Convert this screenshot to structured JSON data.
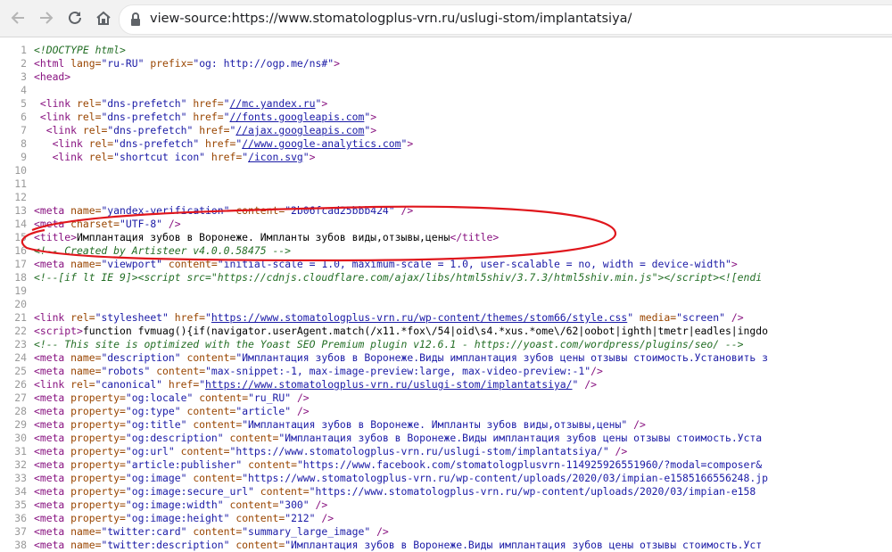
{
  "browser": {
    "url": "view-source:https://www.stomatologplus-vrn.ru/uslugi-stom/implantatsiya/",
    "back_icon": "back-arrow-icon",
    "forward_icon": "forward-arrow-icon",
    "reload_icon": "reload-icon",
    "home_icon": "home-icon",
    "lock_icon": "lock-icon"
  },
  "source_lines": [
    {
      "n": "1",
      "html": "<span class='comment'>&lt;!DOCTYPE html&gt;</span>"
    },
    {
      "n": "2",
      "html": "<span class='tag'>&lt;html</span> <span class='attr'>lang=</span><span class='val'>\"ru-RU\"</span> <span class='attr'>prefix=</span><span class='val'>\"og: http://ogp.me/ns#\"</span><span class='tag'>&gt;</span>"
    },
    {
      "n": "3",
      "html": "<span class='tag'>&lt;head&gt;</span>"
    },
    {
      "n": "4",
      "html": ""
    },
    {
      "n": "5",
      "html": " <span class='tag'>&lt;link</span> <span class='attr'>rel=</span><span class='val'>\"dns-prefetch\"</span> <span class='attr'>href=</span><span class='val'>\"<span class='link'>//mc.yandex.ru</span>\"</span><span class='tag'>&gt;</span>"
    },
    {
      "n": "6",
      "html": " <span class='tag'>&lt;link</span> <span class='attr'>rel=</span><span class='val'>\"dns-prefetch\"</span> <span class='attr'>href=</span><span class='val'>\"<span class='link'>//fonts.googleapis.com</span>\"</span><span class='tag'>&gt;</span>"
    },
    {
      "n": "7",
      "html": "  <span class='tag'>&lt;link</span> <span class='attr'>rel=</span><span class='val'>\"dns-prefetch\"</span> <span class='attr'>href=</span><span class='val'>\"<span class='link'>//ajax.googleapis.com</span>\"</span><span class='tag'>&gt;</span>"
    },
    {
      "n": "8",
      "html": "   <span class='tag'>&lt;link</span> <span class='attr'>rel=</span><span class='val'>\"dns-prefetch\"</span> <span class='attr'>href=</span><span class='val'>\"<span class='link'>//www.google-analytics.com</span>\"</span><span class='tag'>&gt;</span>"
    },
    {
      "n": "9",
      "html": "   <span class='tag'>&lt;link</span> <span class='attr'>rel=</span><span class='val'>\"shortcut icon\"</span> <span class='attr'>href=</span><span class='val'>\"<span class='link'>/icon.svg</span>\"</span><span class='tag'>&gt;</span>"
    },
    {
      "n": "10",
      "html": ""
    },
    {
      "n": "11",
      "html": ""
    },
    {
      "n": "12",
      "html": ""
    },
    {
      "n": "13",
      "html": "<span class='tag'>&lt;meta</span> <span class='attr'>name=</span><span class='val'>\"yandex-verification\"</span> <span class='attr'>content=</span><span class='val'>\"2b06fcad25bbb424\"</span> <span class='tag'>/&gt;</span>"
    },
    {
      "n": "14",
      "html": "<span class='tag'>&lt;meta</span> <span class='attr'>charset=</span><span class='val'>\"UTF-8\"</span> <span class='tag'>/&gt;</span>"
    },
    {
      "n": "15",
      "html": "<span class='tag'>&lt;title&gt;</span>Имплантация зубов в Воронеже. Импланты зубов виды,отзывы,цены<span class='tag'>&lt;/title&gt;</span>"
    },
    {
      "n": "16",
      "html": "<span class='comment'>&lt;!-- Created by Artisteer v4.0.0.58475 --&gt;</span>"
    },
    {
      "n": "17",
      "html": "<span class='tag'>&lt;meta</span> <span class='attr'>name=</span><span class='val'>\"viewport\"</span> <span class='attr'>content=</span><span class='val'>\"initial-scale = 1.0, maximum-scale = 1.0, user-scalable = no, width = device-width\"</span><span class='tag'>&gt;</span>"
    },
    {
      "n": "18",
      "html": "<span class='comment'>&lt;!--[if lt IE 9]&gt;&lt;script src=\"https://cdnjs.cloudflare.com/ajax/libs/html5shiv/3.7.3/html5shiv.min.js\"&gt;&lt;/script&gt;&lt;![endi</span>"
    },
    {
      "n": "19",
      "html": ""
    },
    {
      "n": "20",
      "html": ""
    },
    {
      "n": "21",
      "html": "<span class='tag'>&lt;link</span> <span class='attr'>rel=</span><span class='val'>\"stylesheet\"</span> <span class='attr'>href=</span><span class='val'>\"<span class='link'>https://www.stomatologplus-vrn.ru/wp-content/themes/stom66/style.css</span>\"</span> <span class='attr'>media=</span><span class='val'>\"screen\"</span> <span class='tag'>/&gt;</span>"
    },
    {
      "n": "22",
      "html": "<span class='tag'>&lt;script&gt;</span>function fvmuag(){if(navigator.userAgent.match(/x11.*fox\\/54|oid\\s4.*xus.*ome\\/62|oobot|ighth|tmetr|eadles|ingdo"
    },
    {
      "n": "23",
      "html": "<span class='comment'>&lt;!-- This site is optimized with the Yoast SEO Premium plugin v12.6.1 - https://yoast.com/wordpress/plugins/seo/ --&gt;</span>"
    },
    {
      "n": "24",
      "html": "<span class='tag'>&lt;meta</span> <span class='attr'>name=</span><span class='val'>\"description\"</span> <span class='attr'>content=</span><span class='val'>\"Имплантация зубов в Воронеже.Виды имплантация зубов цены отзывы стоимость.Установить з</span>"
    },
    {
      "n": "25",
      "html": "<span class='tag'>&lt;meta</span> <span class='attr'>name=</span><span class='val'>\"robots\"</span> <span class='attr'>content=</span><span class='val'>\"max-snippet:-1, max-image-preview:large, max-video-preview:-1\"</span><span class='tag'>/&gt;</span>"
    },
    {
      "n": "26",
      "html": "<span class='tag'>&lt;link</span> <span class='attr'>rel=</span><span class='val'>\"canonical\"</span> <span class='attr'>href=</span><span class='val'>\"<span class='link'>https://www.stomatologplus-vrn.ru/uslugi-stom/implantatsiya/</span>\"</span> <span class='tag'>/&gt;</span>"
    },
    {
      "n": "27",
      "html": "<span class='tag'>&lt;meta</span> <span class='attr'>property=</span><span class='val'>\"og:locale\"</span> <span class='attr'>content=</span><span class='val'>\"ru_RU\"</span> <span class='tag'>/&gt;</span>"
    },
    {
      "n": "28",
      "html": "<span class='tag'>&lt;meta</span> <span class='attr'>property=</span><span class='val'>\"og:type\"</span> <span class='attr'>content=</span><span class='val'>\"article\"</span> <span class='tag'>/&gt;</span>"
    },
    {
      "n": "29",
      "html": "<span class='tag'>&lt;meta</span> <span class='attr'>property=</span><span class='val'>\"og:title\"</span> <span class='attr'>content=</span><span class='val'>\"Имплантация зубов в Воронеже. Импланты зубов виды,отзывы,цены\"</span> <span class='tag'>/&gt;</span>"
    },
    {
      "n": "30",
      "html": "<span class='tag'>&lt;meta</span> <span class='attr'>property=</span><span class='val'>\"og:description\"</span> <span class='attr'>content=</span><span class='val'>\"Имплантация зубов в Воронеже.Виды имплантация зубов цены отзывы стоимость.Уста</span>"
    },
    {
      "n": "31",
      "html": "<span class='tag'>&lt;meta</span> <span class='attr'>property=</span><span class='val'>\"og:url\"</span> <span class='attr'>content=</span><span class='val'>\"https://www.stomatologplus-vrn.ru/uslugi-stom/implantatsiya/\"</span> <span class='tag'>/&gt;</span>"
    },
    {
      "n": "32",
      "html": "<span class='tag'>&lt;meta</span> <span class='attr'>property=</span><span class='val'>\"article:publisher\"</span> <span class='attr'>content=</span><span class='val'>\"https://www.facebook.com/stomatologplusvrn-114925926551960/?modal=composer&amp;</span>"
    },
    {
      "n": "33",
      "html": "<span class='tag'>&lt;meta</span> <span class='attr'>property=</span><span class='val'>\"og:image\"</span> <span class='attr'>content=</span><span class='val'>\"https://www.stomatologplus-vrn.ru/wp-content/uploads/2020/03/impian-e1585166556248.jp</span>"
    },
    {
      "n": "34",
      "html": "<span class='tag'>&lt;meta</span> <span class='attr'>property=</span><span class='val'>\"og:image:secure_url\"</span> <span class='attr'>content=</span><span class='val'>\"https://www.stomatologplus-vrn.ru/wp-content/uploads/2020/03/impian-e158</span>"
    },
    {
      "n": "35",
      "html": "<span class='tag'>&lt;meta</span> <span class='attr'>property=</span><span class='val'>\"og:image:width\"</span> <span class='attr'>content=</span><span class='val'>\"300\"</span> <span class='tag'>/&gt;</span>"
    },
    {
      "n": "36",
      "html": "<span class='tag'>&lt;meta</span> <span class='attr'>property=</span><span class='val'>\"og:image:height\"</span> <span class='attr'>content=</span><span class='val'>\"212\"</span> <span class='tag'>/&gt;</span>"
    },
    {
      "n": "37",
      "html": "<span class='tag'>&lt;meta</span> <span class='attr'>name=</span><span class='val'>\"twitter:card\"</span> <span class='attr'>content=</span><span class='val'>\"summary_large_image\"</span> <span class='tag'>/&gt;</span>"
    },
    {
      "n": "38",
      "html": "<span class='tag'>&lt;meta</span> <span class='attr'>name=</span><span class='val'>\"twitter:description\"</span> <span class='attr'>content=</span><span class='val'>\"Имплантация зубов в Воронеже.Виды имплантация зубов цены отзывы стоимость.Уст</span>"
    }
  ],
  "annotation": {
    "color": "#e0161c"
  }
}
